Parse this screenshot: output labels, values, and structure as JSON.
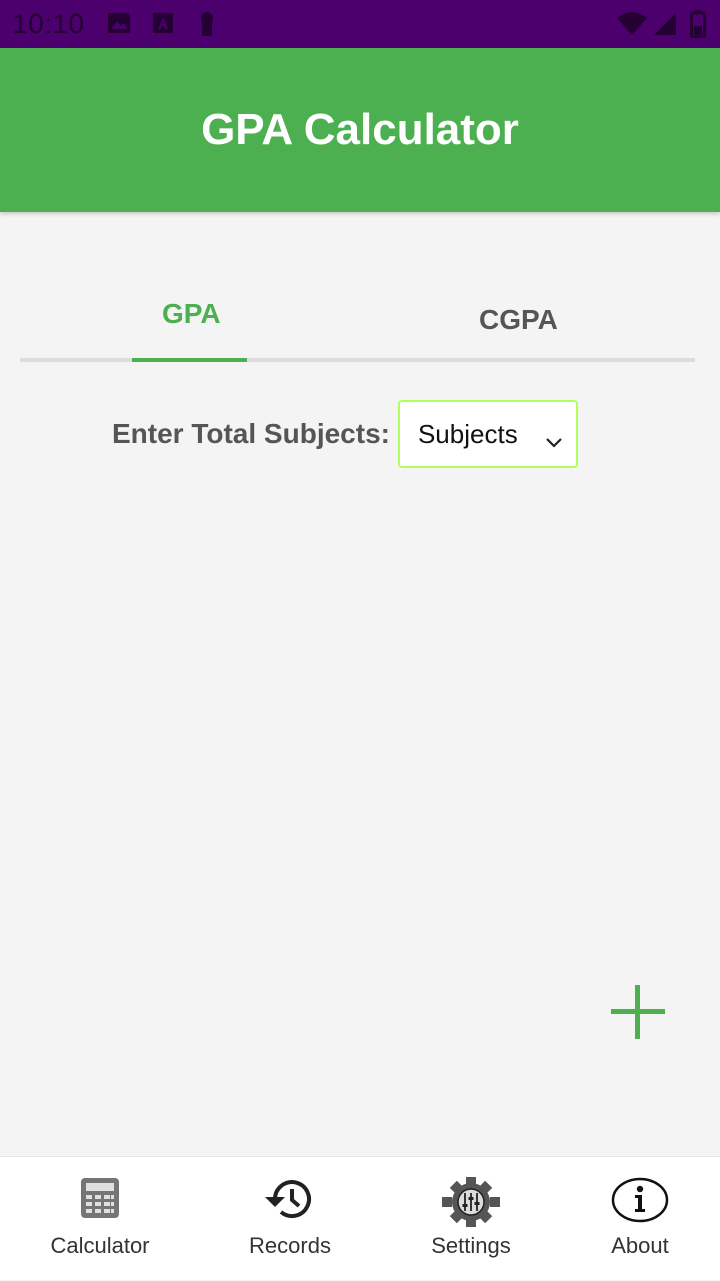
{
  "status_bar": {
    "time": "10:10",
    "icons": [
      "image-icon",
      "a-badge-icon",
      "keyhole-icon",
      "wifi-icon",
      "signal-icon",
      "battery-icon"
    ],
    "background": "#4b006e"
  },
  "app_bar": {
    "title": "GPA Calculator",
    "background": "#4caf50"
  },
  "tabs": [
    {
      "label": "GPA",
      "selected": true
    },
    {
      "label": "CGPA",
      "selected": false
    }
  ],
  "form": {
    "subjects_label": "Enter Total Subjects:",
    "subjects_select": {
      "value": "Subjects",
      "border_color": "#b2ff59"
    }
  },
  "fab": {
    "icon": "plus-icon",
    "color": "#4caf50"
  },
  "bottom_nav": [
    {
      "label": "Calculator",
      "icon": "calculator-icon"
    },
    {
      "label": "Records",
      "icon": "history-icon"
    },
    {
      "label": "Settings",
      "icon": "gear-icon"
    },
    {
      "label": "About",
      "icon": "info-icon"
    }
  ]
}
